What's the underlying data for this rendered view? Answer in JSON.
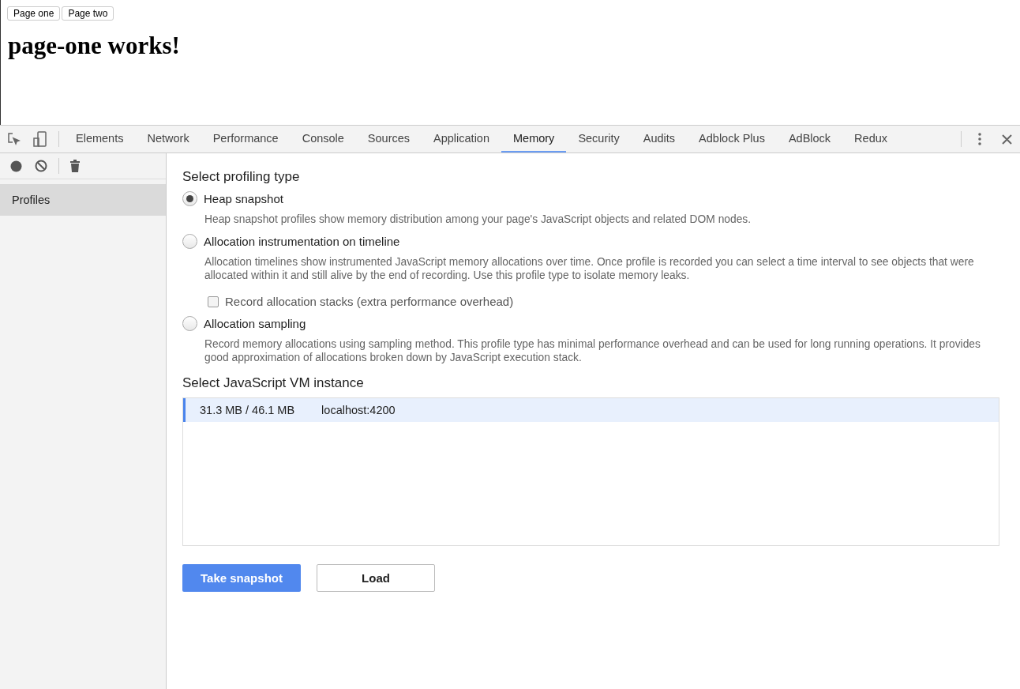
{
  "page": {
    "nav_buttons": [
      "Page one",
      "Page two"
    ],
    "heading": "page-one works!"
  },
  "devtools": {
    "tabs": [
      {
        "label": "Elements",
        "selected": false
      },
      {
        "label": "Network",
        "selected": false
      },
      {
        "label": "Performance",
        "selected": false
      },
      {
        "label": "Console",
        "selected": false
      },
      {
        "label": "Sources",
        "selected": false
      },
      {
        "label": "Application",
        "selected": false
      },
      {
        "label": "Memory",
        "selected": true
      },
      {
        "label": "Security",
        "selected": false
      },
      {
        "label": "Audits",
        "selected": false
      },
      {
        "label": "Adblock Plus",
        "selected": false
      },
      {
        "label": "AdBlock",
        "selected": false
      },
      {
        "label": "Redux",
        "selected": false
      }
    ],
    "sidebar": {
      "items": [
        {
          "label": "Profiles",
          "selected": true
        }
      ]
    },
    "profiling": {
      "title": "Select profiling type",
      "types": [
        {
          "label": "Heap snapshot",
          "selected": true,
          "description": "Heap snapshot profiles show memory distribution among your page's JavaScript objects and related DOM nodes."
        },
        {
          "label": "Allocation instrumentation on timeline",
          "selected": false,
          "description": "Allocation timelines show instrumented JavaScript memory allocations over time. Once profile is recorded you can select a time interval to see objects that were allocated within it and still alive by the end of recording. Use this profile type to isolate memory leaks.",
          "option": {
            "label": "Record allocation stacks (extra performance overhead)",
            "checked": false
          }
        },
        {
          "label": "Allocation sampling",
          "selected": false,
          "description": "Record memory allocations using sampling method. This profile type has minimal performance overhead and can be used for long running operations. It provides good approximation of allocations broken down by JavaScript execution stack."
        }
      ]
    },
    "vm": {
      "title": "Select JavaScript VM instance",
      "instances": [
        {
          "memory": "31.3 MB / 46.1 MB",
          "host": "localhost:4200",
          "selected": true
        }
      ]
    },
    "buttons": {
      "primary": "Take snapshot",
      "secondary": "Load"
    }
  }
}
